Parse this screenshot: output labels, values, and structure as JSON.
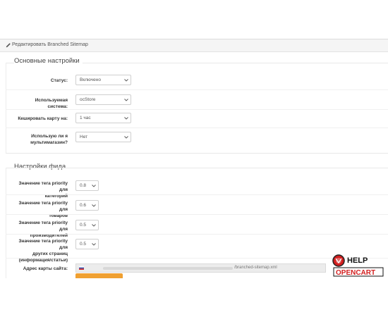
{
  "panel": {
    "title": "Редактировать Branched Sitemap"
  },
  "basic": {
    "legend": "Основные настройки",
    "fields": [
      {
        "label": "Статус:",
        "value": "Включено"
      },
      {
        "label": "Используемая система:",
        "value": "ocStore"
      },
      {
        "label": "Кешировать карту на:",
        "value": "1 час"
      },
      {
        "label_lines": [
          "Использую ли я",
          "мультимагазин?"
        ],
        "value": "Нет"
      }
    ]
  },
  "feed": {
    "legend": "Настройки фида",
    "fields": [
      {
        "label_lines": [
          "Значение тега priority для",
          "категорий"
        ],
        "value": "0.8"
      },
      {
        "label_lines": [
          "Значение тега priority для",
          "товаров"
        ],
        "value": "0.6"
      },
      {
        "label_lines": [
          "Значение тега priority для",
          "производителей"
        ],
        "value": "0.5"
      },
      {
        "label_lines": [
          "Значение тега priority для",
          "других страниц",
          "(информация/статьи)"
        ],
        "value": "0.5"
      }
    ],
    "url_label": "Адрес карты сайта:",
    "url_suffix": "/branched-sitemap.xml"
  },
  "logo": {
    "line1": "HELP",
    "line2": "OPENCART"
  },
  "colors": {
    "accent_orange": "#f0a031",
    "logo_red": "#d21f1f"
  }
}
